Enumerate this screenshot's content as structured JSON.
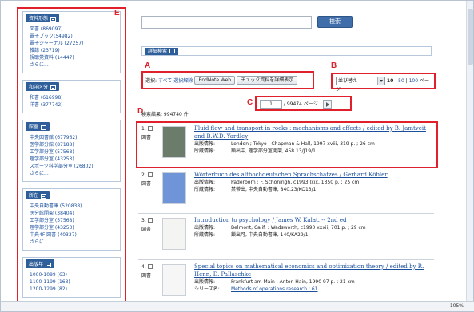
{
  "search": {
    "button_label": "検索",
    "query": ""
  },
  "detail_search": {
    "label": "詳細検索"
  },
  "annotation_labels": {
    "A": "A",
    "B": "B",
    "C": "C",
    "D": "D",
    "E": "E"
  },
  "actions": {
    "select_label": "選択:",
    "select_all": "すべて",
    "deselect": "選択解除",
    "endnote_button": "EndNote Web",
    "detail_button": "チェック資料を詳細表示"
  },
  "sort": {
    "selected": "並び替え",
    "per_page_current": "10",
    "per_page_options": [
      "50",
      "100"
    ],
    "per_page_suffix": "ページ"
  },
  "pager": {
    "current_page": "1",
    "total_pages_text": "/ 99474 ページ"
  },
  "result_count_text": "検索結果: 994740 件",
  "facets": [
    {
      "title": "資料形態",
      "items": [
        "図書 (869097)",
        "電子ブック(54982)",
        "電子ジャーナル (27257)",
        "雑誌 (23719)",
        "視聴覚資料 (14447)"
      ],
      "more": "さらに..."
    },
    {
      "title": "和洋区分",
      "items": [
        "和書 (616998)",
        "洋書 (377742)"
      ],
      "more": ""
    },
    {
      "title": "館室",
      "items": [
        "中央図書館 (677962)",
        "医学部分館 (87188)",
        "工学部分室 (57568)",
        "理学部分室 (43253)",
        "スポーツ科学部分室 (26802)"
      ],
      "more": "さらに..."
    },
    {
      "title": "所在",
      "items": [
        "中央自動書庫 (520838)",
        "医分館開架 (38404)",
        "工学部分室 (57568)",
        "理学部分室 (43253)",
        "中央4F 図書 (40337)"
      ],
      "more": "さらに..."
    },
    {
      "title": "出版年",
      "items": [
        "1000-1099 (63)",
        "1100-1199 (163)",
        "1200-1299 (82)"
      ],
      "more": ""
    }
  ],
  "results": [
    {
      "num": "1.",
      "type": "図書",
      "title": "Fluid flow and transport in rocks : mechanisms and effects / edited by B. Jamtveit and B.W.D. Yardley",
      "meta": [
        {
          "k": "出版情報:",
          "v": "London ; Tokyo : Chapman & Hall, 1997 xviii, 319 p. ; 26 cm"
        },
        {
          "k": "所蔵情報:",
          "v": "鎖出中, 理学部分室開架, 458.13/J19/1"
        }
      ]
    },
    {
      "num": "2.",
      "type": "図書",
      "title": "Wörterbuch des althochdeutschen Sprachschatzes / Gerhard Köbler",
      "meta": [
        {
          "k": "出版情報:",
          "v": "Paderborn : F. Schöningh, c1993 lxix, 1350 p. ; 25 cm"
        },
        {
          "k": "所蔵情報:",
          "v": "禁帯出, 中央自動書庫, 840.23/KO13/1"
        }
      ]
    },
    {
      "num": "3.",
      "type": "図書",
      "title": "Introduction to psychology / James W. Kalat. -- 2nd ed",
      "meta": [
        {
          "k": "出版情報:",
          "v": "Belmont, Calif. : Wadsworth, c1990 xxxii, 701 p. ; 29 cm"
        },
        {
          "k": "所蔵情報:",
          "v": "鎖出可, 中央自動書庫, 140/KA29/1"
        }
      ]
    },
    {
      "num": "4.",
      "type": "図書",
      "title": "Special topics on mathematical economics and optimization theory / edited by R. Henn, D. Pallaschke",
      "meta": [
        {
          "k": "出版情報:",
          "v": "Frankfurt am Main : Anton Hain, 1990 97 p. ; 21 cm"
        },
        {
          "k": "シリーズ名:",
          "v": "Methods of operations research ; 61",
          "link": true
        }
      ]
    }
  ],
  "statusbar": {
    "zoom": "105%"
  },
  "colors": {
    "accent": "#2f5f9a",
    "annotation": "#e0202a",
    "link": "#1a4f9c"
  }
}
